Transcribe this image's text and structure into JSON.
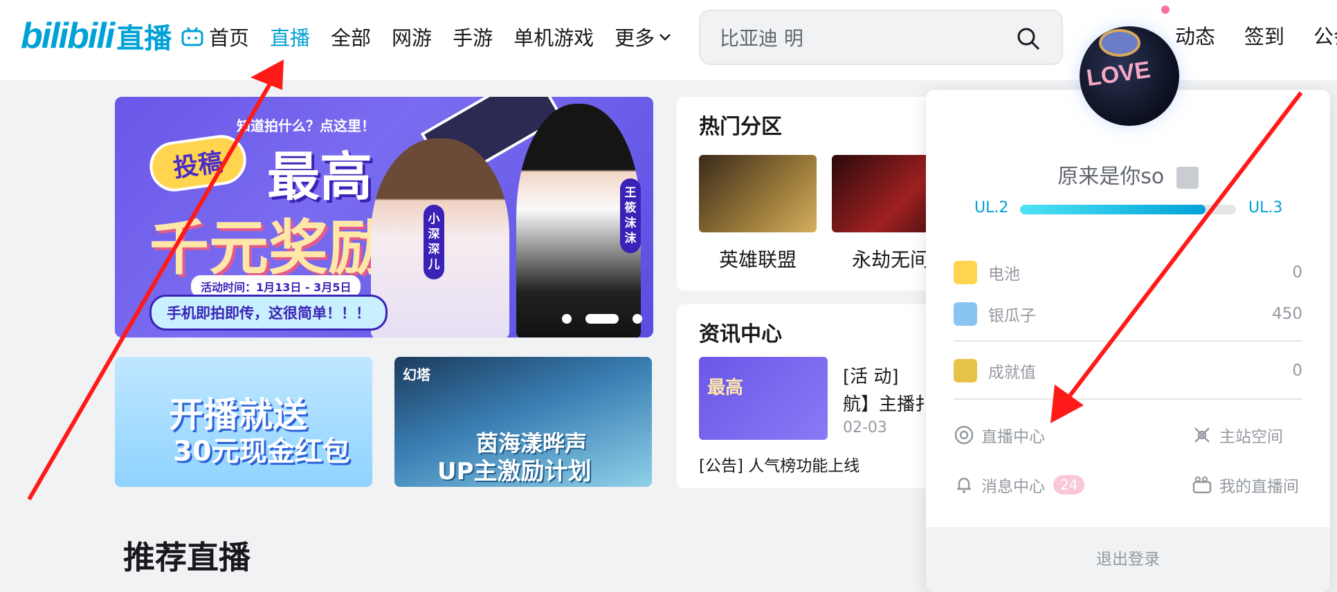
{
  "header": {
    "logo": {
      "bili": "bilibili",
      "live": "直播"
    },
    "nav": [
      {
        "label": "首页"
      },
      {
        "label": "直播"
      },
      {
        "label": "全部"
      },
      {
        "label": "网游"
      },
      {
        "label": "手游"
      },
      {
        "label": "单机游戏"
      },
      {
        "label": "更多"
      }
    ],
    "search": {
      "value": "比亚迪 明"
    },
    "right_links": [
      "动态",
      "签到",
      "公会"
    ]
  },
  "banner": {
    "hint": "知道拍什么？点这里！",
    "tag": "投稿",
    "big1": "最高",
    "big2": "千元奖励!",
    "date": "活动时间：1月13日 - 3月5日",
    "slogan": "手机即拍即传，这很简单！！！",
    "name1": "小深深儿",
    "name2": "王筱沫沫"
  },
  "small_banners": [
    {
      "line1": "开播就送",
      "line2": "30元现金红包"
    },
    {
      "logo": "幻塔",
      "line1": "茵海漾晔声",
      "line2": "UP主激励计划"
    }
  ],
  "hot": {
    "title": "热门分区",
    "games": [
      {
        "name": "英雄联盟"
      },
      {
        "name": "永劫无间"
      }
    ]
  },
  "news": {
    "title": "资讯中心",
    "thumb_text": "最高",
    "tag": "[活 动]",
    "text": "航】主播扌",
    "date": "02-03",
    "line": "[公告] 人气榜功能上线"
  },
  "section_title": "推荐直播",
  "user_panel": {
    "avatar_text": "LOVE",
    "username": "原来是你so",
    "level_current": "UL.2",
    "level_next": "UL.3",
    "level_progress": 0.86,
    "rows": [
      {
        "label": "电池",
        "value": "0"
      },
      {
        "label": "银瓜子",
        "value": "450"
      },
      {
        "label": "成就值",
        "value": "0"
      }
    ],
    "links": {
      "live_center": "直播中心",
      "main_space": "主站空间",
      "messages": "消息中心",
      "messages_count": "24",
      "my_room": "我的直播间"
    },
    "logout": "退出登录"
  },
  "colors": {
    "accent": "#00a1d6",
    "pink": "#fb7299",
    "annotation_arrow": "#ff0000"
  }
}
